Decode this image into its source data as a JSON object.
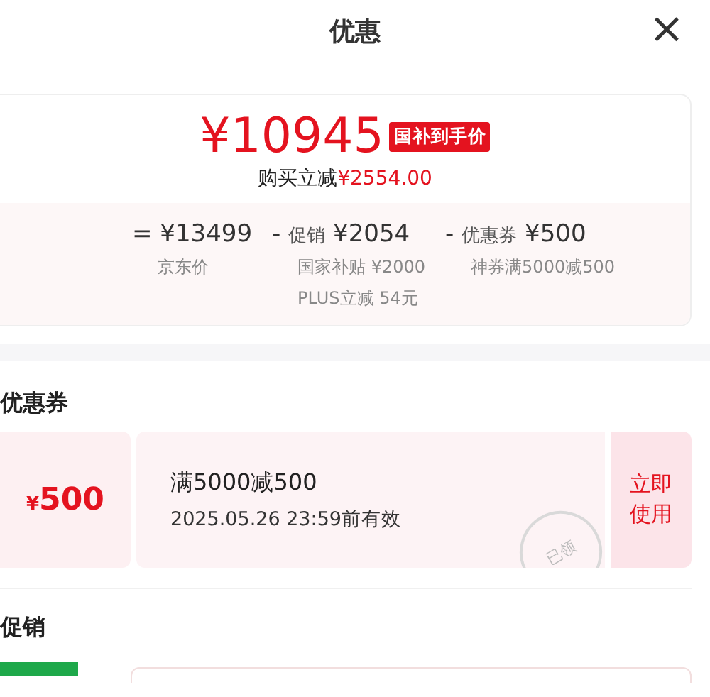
{
  "header": {
    "title": "优惠",
    "close": "×"
  },
  "price": {
    "amount": "¥10945",
    "tag": "国补到手价",
    "saving_label": "购买立减",
    "saving_amount": "¥2554.00"
  },
  "breakdown": [
    {
      "op": "=",
      "amount": "¥13499",
      "notes": [
        "京东价"
      ]
    },
    {
      "op": "-",
      "label": "促销",
      "amount": "¥2054",
      "notes": [
        "国家补贴 ¥2000",
        "PLUS立减 54元"
      ]
    },
    {
      "op": "-",
      "label": "优惠券",
      "amount": "¥500",
      "notes": [
        "神券满5000减500"
      ]
    }
  ],
  "coupon_section": {
    "title": "优惠券",
    "coupons": [
      {
        "symbol": "¥",
        "value": "500",
        "condition": "满5000减500",
        "validity": "2025.05.26 23:59前有效",
        "stamp": "已领",
        "claimed": true,
        "action": "立即使用"
      }
    ]
  },
  "promo_section": {
    "title": "促销"
  }
}
